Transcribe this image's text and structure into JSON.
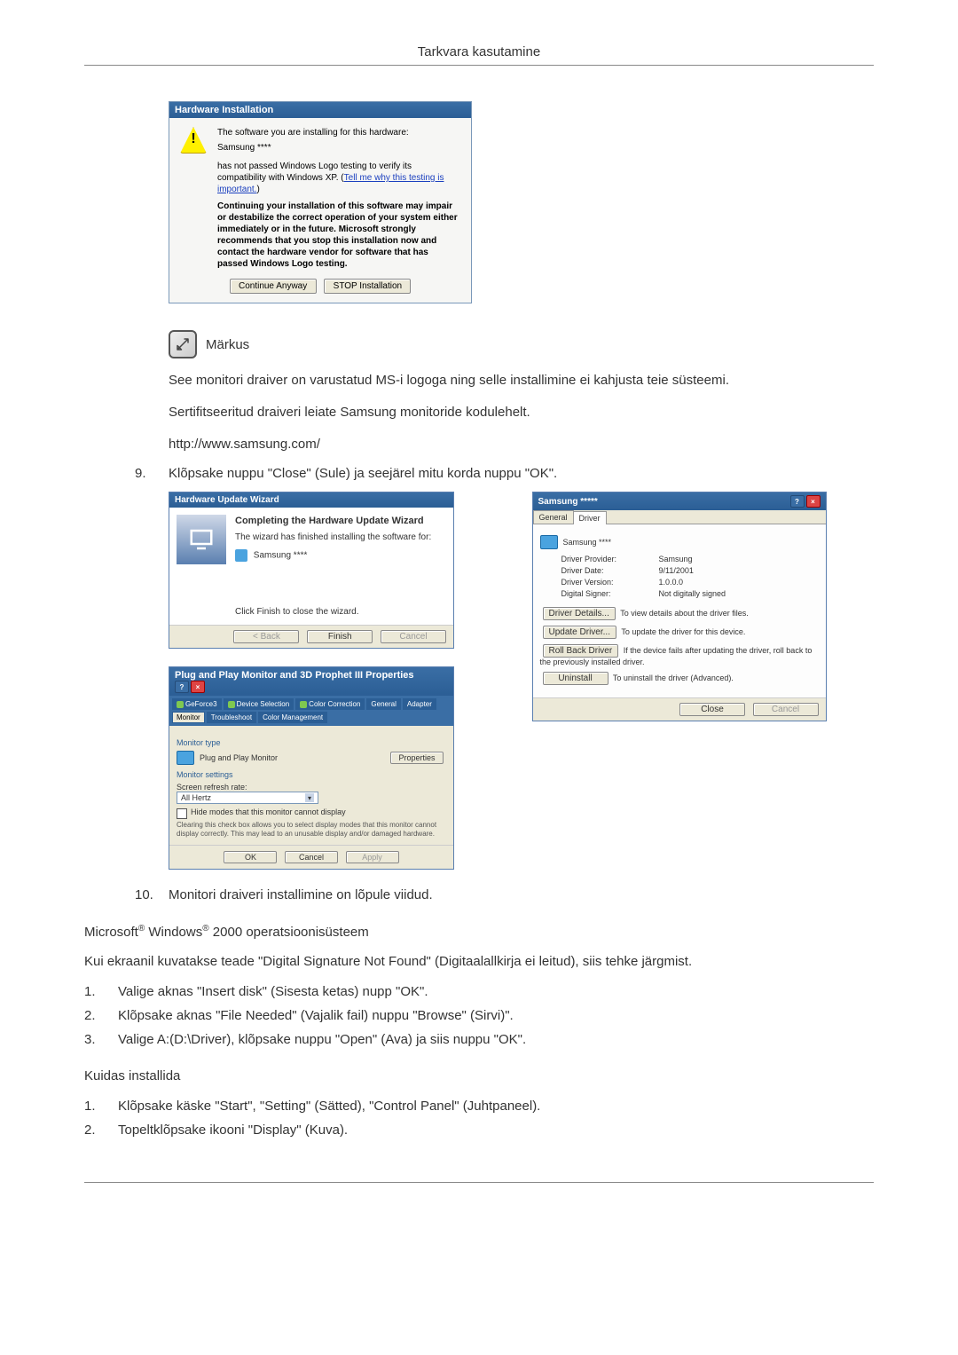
{
  "header": {
    "title": "Tarkvara kasutamine"
  },
  "hw_install": {
    "title": "Hardware Installation",
    "line1": "The software you are installing for this hardware:",
    "device": "Samsung ****",
    "line2a": "has not passed Windows Logo testing to verify its compatibility with Windows XP. (",
    "line2link": "Tell me why this testing is important.",
    "line2b": ")",
    "bold": "Continuing your installation of this software may impair or destabilize the correct operation of your system either immediately or in the future. Microsoft strongly recommends that you stop this installation now and contact the hardware vendor for software that has passed Windows Logo testing.",
    "btn_continue": "Continue Anyway",
    "btn_stop": "STOP Installation"
  },
  "note": {
    "label": "Märkus",
    "p1": "See monitori draiver on varustatud MS-i logoga ning selle installimine ei kahjusta teie süsteemi.",
    "p2": "Sertifitseeritud draiveri leiate Samsung monitoride kodulehelt.",
    "url": "http://www.samsung.com/"
  },
  "step9": {
    "num": "9.",
    "text": "Klõpsake nuppu \"Close\" (Sule) ja seejärel mitu korda nuppu \"OK\"."
  },
  "wizard": {
    "title": "Hardware Update Wizard",
    "heading": "Completing the Hardware Update Wizard",
    "sub": "The wizard has finished installing the software for:",
    "device": "Samsung ****",
    "footer": "Click Finish to close the wizard.",
    "btn_back": "< Back",
    "btn_finish": "Finish",
    "btn_cancel": "Cancel"
  },
  "driver_props": {
    "title": "Samsung *****",
    "tabs": {
      "general": "General",
      "driver": "Driver"
    },
    "device": "Samsung ****",
    "rows": {
      "provider_k": "Driver Provider:",
      "provider_v": "Samsung",
      "date_k": "Driver Date:",
      "date_v": "9/11/2001",
      "version_k": "Driver Version:",
      "version_v": "1.0.0.0",
      "signer_k": "Digital Signer:",
      "signer_v": "Not digitally signed"
    },
    "btns": {
      "details": "Driver Details...",
      "details_d": "To view details about the driver files.",
      "update": "Update Driver...",
      "update_d": "To update the driver for this device.",
      "rollback": "Roll Back Driver",
      "rollback_d": "If the device fails after updating the driver, roll back to the previously installed driver.",
      "uninstall": "Uninstall",
      "uninstall_d": "To uninstall the driver (Advanced)."
    },
    "close": "Close",
    "cancel": "Cancel"
  },
  "mon_props": {
    "title": "Plug and Play Monitor and 3D Prophet III Properties",
    "nvtabs": {
      "a": "GeForce3",
      "b": "Device Selection",
      "c": "Color Correction",
      "d": "General",
      "e": "Adapter",
      "f": "Monitor",
      "g": "Troubleshoot",
      "h": "Color Management"
    },
    "group_type": "Monitor type",
    "type_value": "Plug and Play Monitor",
    "btn_properties": "Properties",
    "group_settings": "Monitor settings",
    "refresh_label": "Screen refresh rate:",
    "refresh_value": "All Hertz",
    "checkbox": "Hide modes that this monitor cannot display",
    "check_desc": "Clearing this check box allows you to select display modes that this monitor cannot display correctly. This may lead to an unusable display and/or damaged hardware.",
    "btn_ok": "OK",
    "btn_cancel": "Cancel",
    "btn_apply": "Apply"
  },
  "step10": {
    "num": "10.",
    "text": "Monitori draiveri installimine on lõpule viidud."
  },
  "os": {
    "prefix": "Microsoft",
    "reg1": "®",
    "win": " Windows",
    "reg2": "®",
    "suffix": " 2000 operatsioonisüsteem"
  },
  "p_dsnf": "Kui ekraanil kuvatakse teade \"Digital Signature Not Found\" (Digitaalallkirja ei leitud), siis tehke järgmist.",
  "dsnf_steps": {
    "s1n": "1.",
    "s1": "Valige aknas \"Insert disk\" (Sisesta ketas) nupp \"OK\".",
    "s2n": "2.",
    "s2": "Klõpsake aknas \"File Needed\" (Vajalik fail) nuppu \"Browse\" (Sirvi)\".",
    "s3n": "3.",
    "s3": "Valige A:(D:\\Driver), klõpsake nuppu \"Open\" (Ava) ja siis nuppu \"OK\"."
  },
  "howto": {
    "title": "Kuidas installida",
    "s1n": "1.",
    "s1": "Klõpsake käske \"Start\", \"Setting\" (Sätted), \"Control Panel\" (Juhtpaneel).",
    "s2n": "2.",
    "s2": "Topeltklõpsake ikooni \"Display\" (Kuva)."
  }
}
